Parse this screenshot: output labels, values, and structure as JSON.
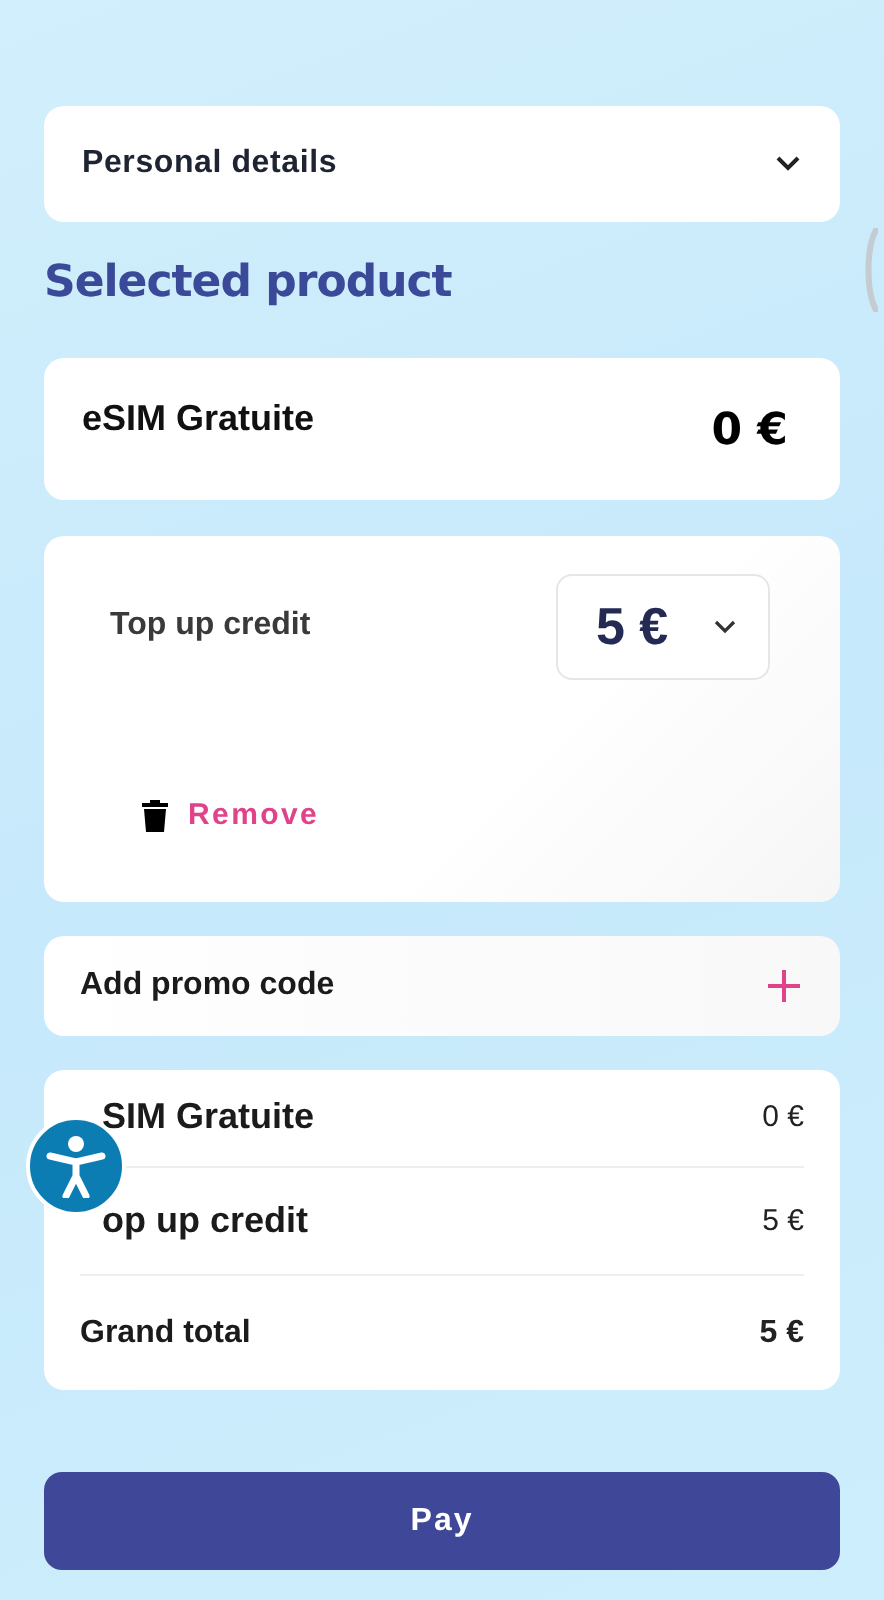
{
  "personal_details": {
    "label": "Personal details",
    "expanded": false
  },
  "heading": "Selected product",
  "product": {
    "name": "eSIM Gratuite",
    "price": "0 €"
  },
  "top_up": {
    "label": "Top up credit",
    "amount": "5 €",
    "remove": "Remove"
  },
  "promo": {
    "label": "Add promo code"
  },
  "summary": {
    "rows": [
      {
        "label": "SIM Gratuite",
        "value": "0 €"
      },
      {
        "label": "op up credit",
        "value": "5 €"
      }
    ],
    "total": {
      "label": "Grand total",
      "value": "5 €"
    }
  },
  "pay_button": "Pay"
}
